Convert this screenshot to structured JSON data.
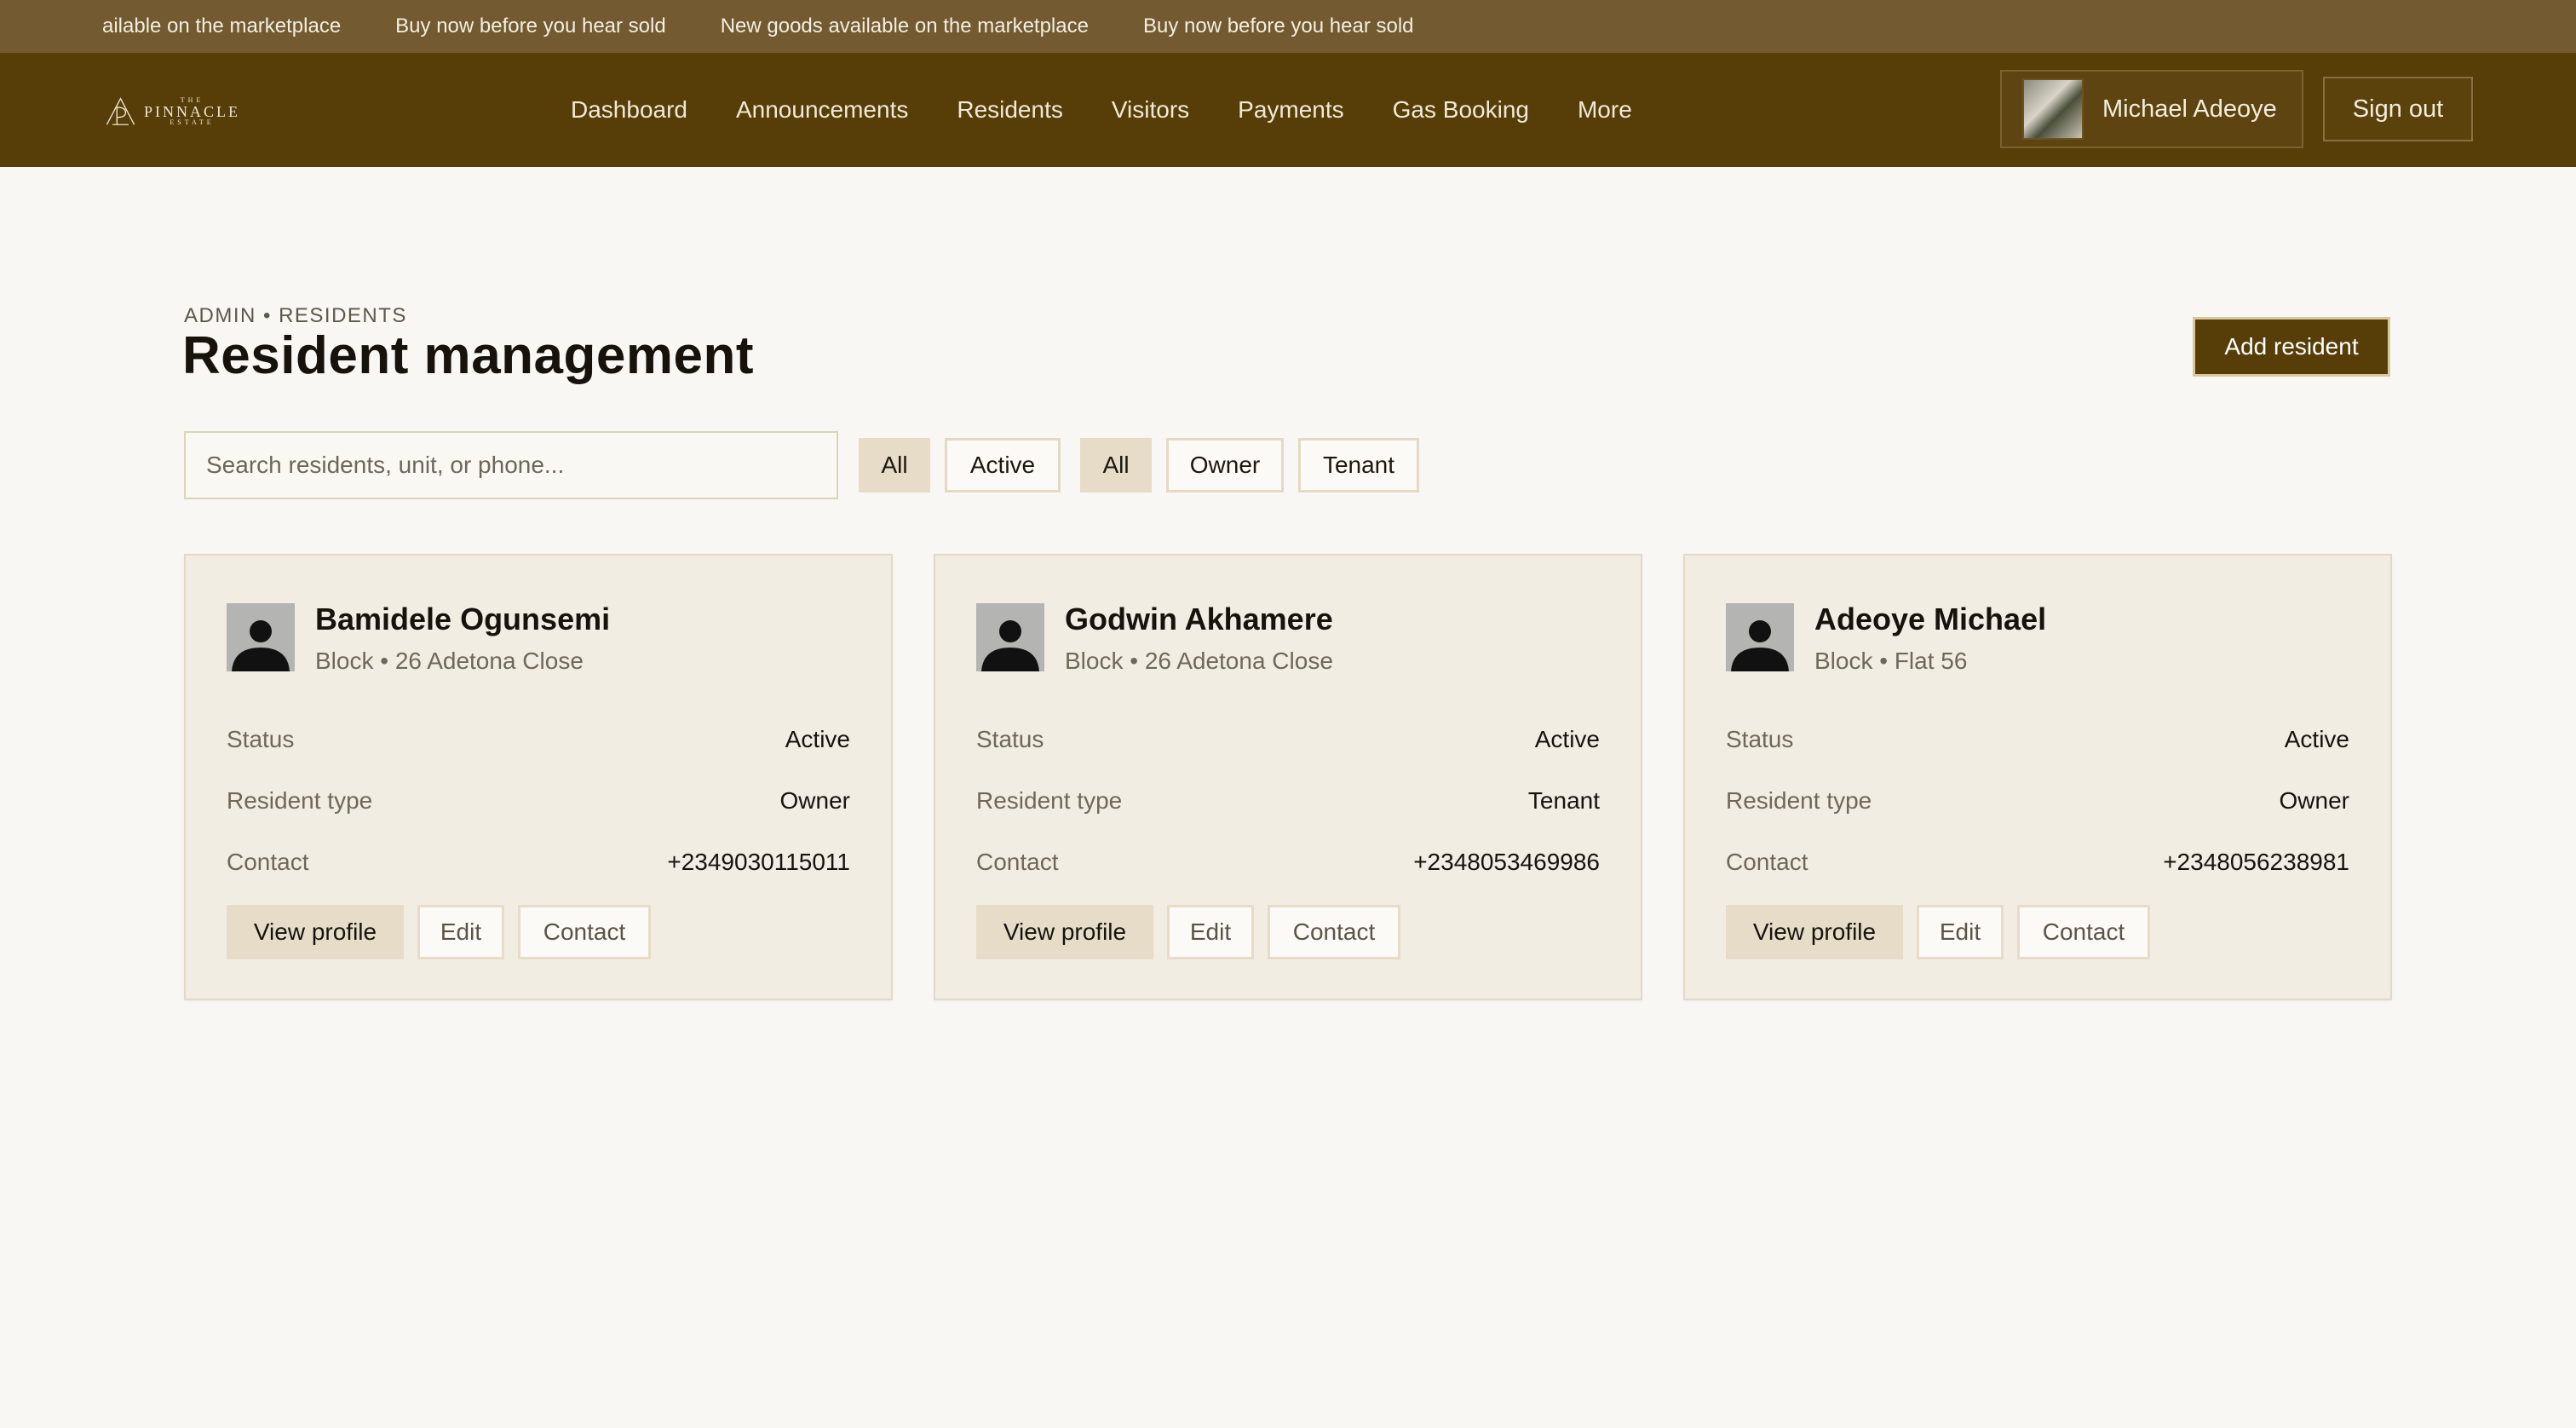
{
  "ticker": [
    "ailable on the marketplace",
    "Buy now before you hear sold",
    "New goods available on the marketplace",
    "Buy now before you hear sold"
  ],
  "brand": {
    "name": "PINNACLE",
    "top_small": "THE",
    "bottom_small": "ESTATE"
  },
  "nav": [
    "Dashboard",
    "Announcements",
    "Residents",
    "Visitors",
    "Payments",
    "Gas Booking",
    "More"
  ],
  "user": {
    "name": "Michael Adeoye"
  },
  "signout_label": "Sign out",
  "breadcrumb": "ADMIN • RESIDENTS",
  "title": "Resident management",
  "add_label": "Add resident",
  "search": {
    "placeholder": "Search residents, unit, or phone..."
  },
  "filters": [
    "All",
    "Active",
    "All",
    "Owner",
    "Tenant"
  ],
  "labels": {
    "status": "Status",
    "type": "Resident type",
    "contact": "Contact"
  },
  "actions": {
    "view": "View profile",
    "edit": "Edit",
    "contact": "Contact"
  },
  "residents": [
    {
      "name": "Bamidele Ogunsemi",
      "unit": "Block • 26 Adetona Close",
      "status": "Active",
      "type": "Owner",
      "contact": "+2349030115011"
    },
    {
      "name": "Godwin Akhamere",
      "unit": "Block • 26 Adetona Close",
      "status": "Active",
      "type": "Tenant",
      "contact": "+2348053469986"
    },
    {
      "name": "Adeoye Michael",
      "unit": "Block • Flat 56",
      "status": "Active",
      "type": "Owner",
      "contact": "+2348056238981"
    }
  ]
}
